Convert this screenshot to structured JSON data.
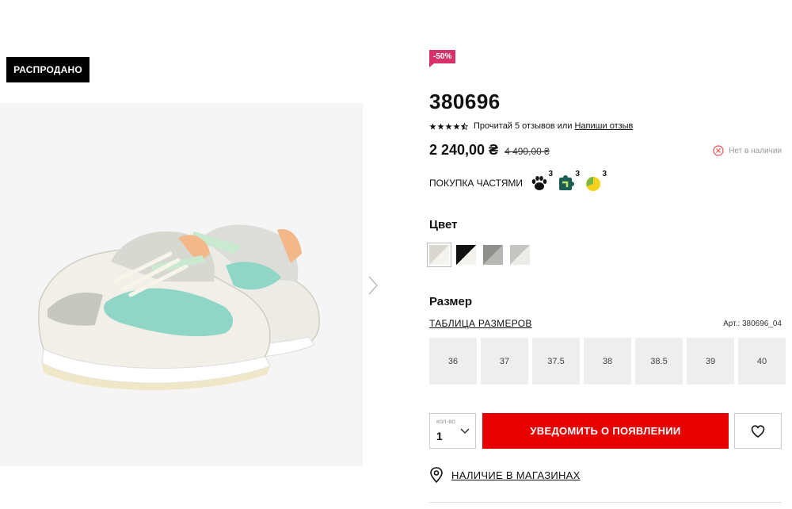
{
  "badge": {
    "sold_out": "РАСПРОДАНО"
  },
  "product": {
    "discount": "-50%",
    "title": "380696",
    "rating": {
      "value": 4.5,
      "max": 5,
      "read_text": "Прочитай 5 отзывов или",
      "write_text": "Напиши отзыв"
    },
    "price": "2 240,00 ₴",
    "old_price": "4 490,00 ₴",
    "stock_status": "Нет в наличии",
    "installment": {
      "label": "ПОКУПКА ЧАСТЯМИ",
      "badges": [
        "3",
        "3",
        "3"
      ]
    },
    "color_label": "Цвет",
    "colors": [
      "#e3e1dc",
      "#1b1b1b",
      "#9a9c98",
      "#cfcfcc"
    ],
    "size_label": "Размер",
    "size_table": "ТАБЛИЦА РАЗМЕРОВ",
    "article": "Арт.: 380696_04",
    "sizes": [
      "36",
      "37",
      "37.5",
      "38",
      "38.5",
      "39",
      "40"
    ],
    "qty_label": "кол-во",
    "qty_value": "1",
    "notify_button": "УВЕДОМИТЬ О ПОЯВЛЕНИИ",
    "stores_link": "НАЛИЧИЕ В МАГАЗИНАХ"
  },
  "icons": {
    "star": "star-icon",
    "stock": "x-circle-icon",
    "wish": "heart-icon",
    "location": "map-pin-icon",
    "next": "chevron-right-icon"
  },
  "colors": {
    "accent_red": "#e60000",
    "discount_pink": "#d6336c"
  }
}
